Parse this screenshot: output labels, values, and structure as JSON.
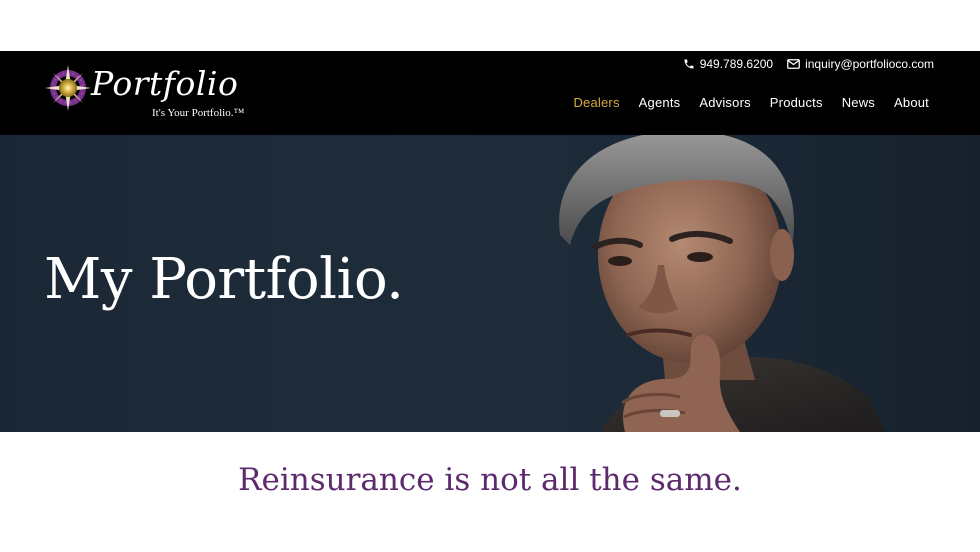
{
  "header": {
    "logo": {
      "wordmark": "Portfolio",
      "tagline": "It's Your Portfolio.™"
    },
    "contact": {
      "phone": "949.789.6200",
      "email": "inquiry@portfolioco.com"
    },
    "nav": [
      {
        "label": "Dealers",
        "active": true
      },
      {
        "label": "Agents",
        "active": false
      },
      {
        "label": "Advisors",
        "active": false
      },
      {
        "label": "Products",
        "active": false
      },
      {
        "label": "News",
        "active": false
      },
      {
        "label": "About",
        "active": false
      }
    ]
  },
  "hero": {
    "title": "My Portfolio.",
    "image": "portrait-photo"
  },
  "tagline": "Reinsurance is not all the same.",
  "colors": {
    "header_background": "#000000",
    "nav_active": "#d6ad43",
    "hero_background": "#1e2b39",
    "tagline_text": "#5e2a6e",
    "logo_accent": "#7a2e8e"
  },
  "icons": {
    "phone": "phone-icon",
    "email": "envelope-icon",
    "logo_mark": "compass-star-icon"
  }
}
